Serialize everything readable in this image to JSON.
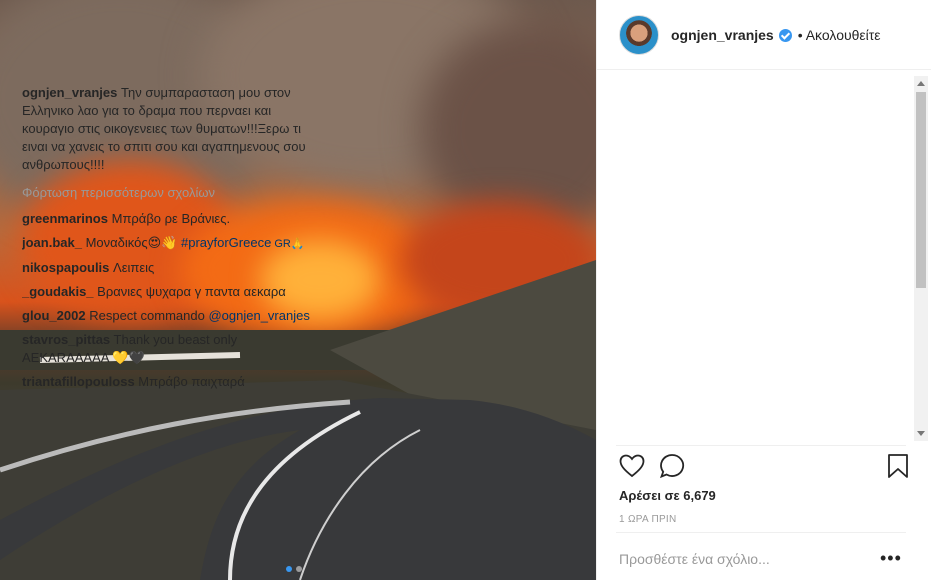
{
  "post": {
    "username": "ognjen_vranjes",
    "follow_label": "• Ακολουθείτε",
    "caption_user": "ognjen_vranjes",
    "caption_text": "Την συμπαρασταση μου στον Ελληνικο λαο για το δραμα που περναει και κουραγιο στις οικογενειες των θυματων!!!Ξερω τι ειναι να χανεις το σπιτι σου και αγαπημενους σου ανθρωπους!!!!",
    "load_more": "Φόρτωση περισσότερων σχολίων",
    "comments": [
      {
        "user": "greenmarinos",
        "text": "Μπράβο ρε Βράνιες."
      },
      {
        "user": "joan.bak_",
        "text": "Μοναδικός😍👋 ",
        "tag": "#prayforGreece",
        "tail": " GR🙏"
      },
      {
        "user": "nikospapoulis",
        "text": "Λειπεις"
      },
      {
        "user": "_goudakis_",
        "text": "Βρανιες ψυχαρα γ παντα αεκαρα"
      },
      {
        "user": "glou_2002",
        "text": "Respect commando ",
        "tag": "@ognjen_vranjes"
      },
      {
        "user": "stavros_pittas",
        "text": "Thank you beast only ΑΕΚΑRΑΑΑΑΑ 💛🖤"
      },
      {
        "user": "triantafillopouloss",
        "text": "Μπράβο παιχταρά"
      }
    ],
    "likes": "Αρέσει σε 6,679",
    "time": "1 ΩΡΑ ΠΡΙΝ",
    "add_comment_placeholder": "Προσθέστε ένα σχόλιο...",
    "more_label": "•••"
  },
  "carousel": {
    "count": 2,
    "active": 0
  },
  "colors": {
    "accent": "#3897f0",
    "link": "#003569"
  }
}
